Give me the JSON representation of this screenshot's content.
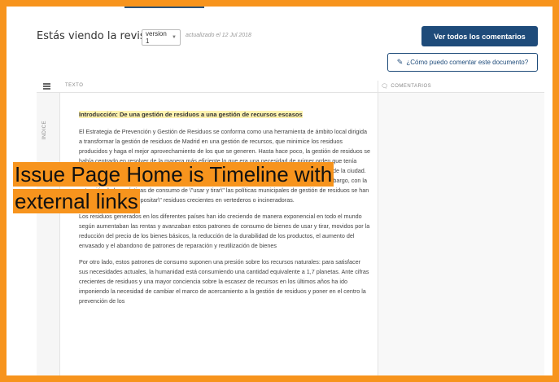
{
  "header": {
    "revision_title": "Estás viendo la revisión",
    "version_value": "version 1",
    "updated_text": "actualizado el 12 Jul 2018",
    "all_comments_label": "Ver todos los comentarios",
    "how_comment_label": "¿Cómo puedo comentar este documento?"
  },
  "columns": {
    "texto": "TEXTO",
    "comentarios": "COMENTARIOS",
    "indice": "ÍNDICE"
  },
  "document": {
    "heading": "Introducción: De una gestión de residuos a una gestión de recursos escasos",
    "paragraphs": [
      "El Estrategia de Prevención y Gestión de Residuos se conforma como una herramienta de ámbito local dirigida a transformar la gestión de residuos de Madrid en una gestión de recursos, que minimice los residuos producidos y haga el mejor aprovechamiento de los que se generen. Hasta hace poco, la gestión de residuos se había centrado en resolver de la manera más eficiente lo que era una necesidad de primer orden que tenía como objetivo la recogida y el tratamiento de los residuos para garantizar la limpieza y salubridad de la ciudad. Más recientemente, también para reducir los impactos en el medio ambiente y en la salud. Sin embargo, con la extensión de las prácticas de consumo de \\\"usar y tirar\\\" las políticas municipales de gestión de residuos se han dirigido a \\\"recoger y depositar\\\" residuos crecientes en vertederos o incineradoras.",
      "Los residuos generados en los diferentes países han ido creciendo de manera exponencial en todo el mundo según aumentaban las rentas y avanzaban estos patrones de consumo de bienes de usar y tirar, movidos por la reducción del precio de los bienes básicos, la reducción de la durabilidad de los productos, el aumento del envasado y el abandono de patrones de reparación y reutilización de bienes",
      "Por otro lado, estos patrones de consumo suponen una presión sobre los recursos naturales: para satisfacer sus necesidades actuales, la humanidad está consumiendo una cantidad equivalente a 1,7 planetas. Ante cifras crecientes de residuos y una mayor conciencia sobre la escasez de recursos en los últimos años ha ido imponiendo la necesidad de cambiar el marco de acercamiento a la gestión de residuos y poner en el centro la prevención de los"
    ]
  },
  "banner": {
    "line1": "Issue Page Home is Timeline with",
    "line2": "external links"
  },
  "colors": {
    "frame": "#f7941d",
    "primary": "#1e4b7a"
  }
}
